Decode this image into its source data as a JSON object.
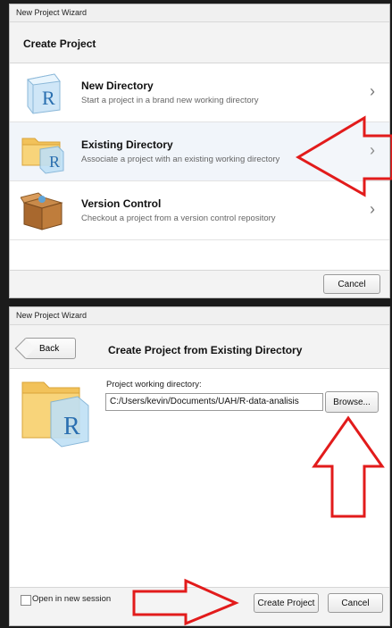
{
  "top_window": {
    "title": "New Project Wizard",
    "heading": "Create Project",
    "options": [
      {
        "title": "New Directory",
        "desc": "Start a project in a brand new working directory"
      },
      {
        "title": "Existing Directory",
        "desc": "Associate a project with an existing working directory"
      },
      {
        "title": "Version Control",
        "desc": "Checkout a project from a version control repository"
      }
    ],
    "cancel_label": "Cancel"
  },
  "bottom_window": {
    "title": "New Project Wizard",
    "back_label": "Back",
    "heading": "Create Project from Existing Directory",
    "field_label": "Project working directory:",
    "path_value": "C:/Users/kevin/Documents/UAH/R-data-analisis",
    "browse_label": "Browse...",
    "new_session_label": "Open in new session",
    "create_label": "Create Project",
    "cancel_label": "Cancel"
  },
  "icons": {
    "r_letter": "R",
    "new_directory": "r-cube-icon",
    "existing_directory": "folder-r-icon",
    "version_control": "box-icon",
    "chevron": "chevron-right-icon"
  },
  "colors": {
    "annotation_arrow": "#e21b1b",
    "selected_row": "#f1f5fa"
  }
}
